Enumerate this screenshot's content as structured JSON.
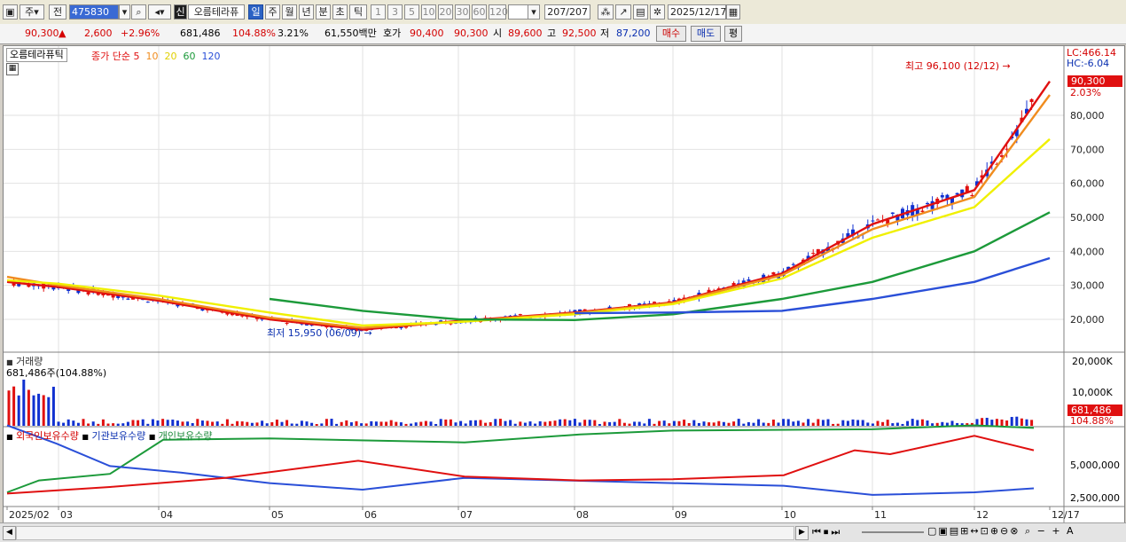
{
  "toolbar": {
    "market_label": "주",
    "prefix_label": "전",
    "code": "475830",
    "badge_label": "신",
    "stock_name": "오름테라퓨",
    "periods": [
      "일",
      "주",
      "월",
      "년",
      "분",
      "초",
      "틱"
    ],
    "active_period": "일",
    "minute_steps": [
      "1",
      "3",
      "5",
      "10",
      "20",
      "30",
      "60",
      "120"
    ],
    "count_label": "207/207",
    "date_value": "2025/12/17"
  },
  "quote": {
    "price": "90,300",
    "direction": "▲",
    "change": "2,600",
    "change_pct": "+2.96%",
    "volume": "681,486",
    "volume_ratio": "104.88%",
    "turnover": "3.21%",
    "amount": "61,550백만",
    "bid_label": "호가",
    "bid1": "90,400",
    "bid2": "90,300",
    "open_label": "시",
    "open": "89,600",
    "high_label": "고",
    "high": "92,500",
    "low_label": "저",
    "low": "87,200",
    "buy_label": "매수",
    "sell_label": "매도",
    "eval_label": "평"
  },
  "legend": {
    "name": "오름테라퓨틱",
    "ma_prefix": "종가 단순",
    "ma_periods": [
      "5",
      "10",
      "20",
      "60",
      "120"
    ],
    "ma_colors": [
      "#e01010",
      "#f08c1e",
      "#f0f000",
      "#1c9a3a",
      "#2a4fd8"
    ]
  },
  "annotations": {
    "lc": "LC:466.14",
    "hc": "HC:-6.04",
    "high_note": "최고 96,100 (12/12)",
    "low_note": "최저 15,950 (06/09)",
    "price_tag": "90,300",
    "price_pct": "2.03%"
  },
  "volume_panel": {
    "title": "거래량",
    "value_text": "681,486주(104.88%)",
    "tag": "681,486",
    "tag_pct": "104.88%",
    "ticks": [
      "20,000K",
      "10,000K"
    ]
  },
  "holding_panel": {
    "titles": [
      "외국인보유수량",
      "기관보유수량",
      "개인보유수량"
    ],
    "ticks": [
      "5,000,000",
      "2,500,000"
    ]
  },
  "colors": {
    "up": "#e01010",
    "down": "#1030d0"
  },
  "chart_data": {
    "type": "candlestick",
    "y_ticks": [
      "20,000",
      "30,000",
      "40,000",
      "50,000",
      "60,000",
      "70,000",
      "80,000"
    ],
    "ylim": [
      13000,
      100000
    ],
    "x_ticks": [
      "2025/02",
      "03",
      "04",
      "05",
      "06",
      "07",
      "08",
      "09",
      "10",
      "11",
      "12",
      "12/17"
    ],
    "series": [
      {
        "name": "5",
        "points": [
          [
            "2025/02",
            31000
          ],
          [
            "03",
            29500
          ],
          [
            "04",
            25500
          ],
          [
            "05",
            20000
          ],
          [
            "06",
            17000
          ],
          [
            "07",
            19500
          ],
          [
            "08",
            22000
          ],
          [
            "09",
            25000
          ],
          [
            "10",
            33500
          ],
          [
            "11",
            48000
          ],
          [
            "12",
            58000
          ],
          [
            "12/17",
            90000
          ]
        ]
      },
      {
        "name": "10",
        "points": [
          [
            "2025/02",
            32500
          ],
          [
            "03",
            30000
          ],
          [
            "04",
            26000
          ],
          [
            "05",
            20500
          ],
          [
            "06",
            17500
          ],
          [
            "07",
            19300
          ],
          [
            "08",
            21800
          ],
          [
            "09",
            24800
          ],
          [
            "10",
            33000
          ],
          [
            "11",
            46500
          ],
          [
            "12",
            56000
          ],
          [
            "12/17",
            86000
          ]
        ]
      },
      {
        "name": "20",
        "points": [
          [
            "2025/02",
            31500
          ],
          [
            "03",
            30500
          ],
          [
            "04",
            27000
          ],
          [
            "05",
            22000
          ],
          [
            "06",
            18200
          ],
          [
            "07",
            19200
          ],
          [
            "08",
            21500
          ],
          [
            "09",
            24500
          ],
          [
            "10",
            32000
          ],
          [
            "11",
            44000
          ],
          [
            "12",
            53000
          ],
          [
            "12/17",
            73000
          ]
        ]
      },
      {
        "name": "60",
        "points": [
          [
            "05",
            26000
          ],
          [
            "06",
            22500
          ],
          [
            "07",
            20000
          ],
          [
            "08",
            19800
          ],
          [
            "09",
            21500
          ],
          [
            "10",
            26000
          ],
          [
            "11",
            31000
          ],
          [
            "12",
            40000
          ],
          [
            "12/17",
            51500
          ]
        ]
      },
      {
        "name": "120",
        "points": [
          [
            "08",
            21800
          ],
          [
            "09",
            22000
          ],
          [
            "10",
            22500
          ],
          [
            "11",
            26000
          ],
          [
            "12",
            31000
          ],
          [
            "12/17",
            38000
          ]
        ]
      }
    ],
    "high": {
      "date": "12/12",
      "value": 96100
    },
    "low": {
      "date": "06/09",
      "value": 15950
    },
    "last": 90300
  }
}
